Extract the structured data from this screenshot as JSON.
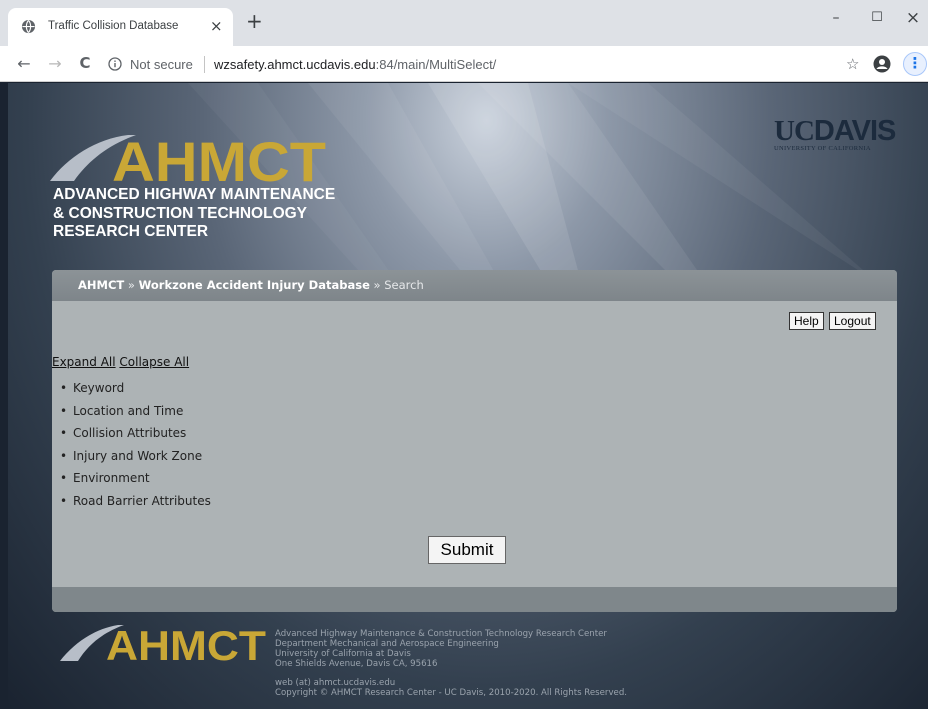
{
  "browser": {
    "tab_title": "Traffic Collision Database",
    "tab_close": "×",
    "new_tab": "+",
    "security_label": "Not secure",
    "url_host": "wzsafety.ahmct.ucdavis.edu",
    "url_path": ":84/main/MultiSelect/",
    "window_controls": {
      "minimize": "–",
      "maximize": "☐",
      "close": "×"
    },
    "nav": {
      "back": "←",
      "forward": "→",
      "reload": "C"
    },
    "bookmark_star": "☆",
    "menu": "⋮"
  },
  "header": {
    "logo_word": "AHMCT",
    "logo_lines": [
      "ADVANCED HIGHWAY MAINTENANCE",
      "& CONSTRUCTION TECHNOLOGY",
      "RESEARCH CENTER"
    ],
    "uc_prefix": "UC",
    "uc_name": "DAVIS",
    "uc_sub": "UNIVERSITY OF CALIFORNIA",
    "logo_color": "#c9a736"
  },
  "breadcrumb": {
    "home": "AHMCT",
    "separator": "»",
    "database": "Workzone Accident Injury Database",
    "current": "Search"
  },
  "buttons": {
    "help": "Help",
    "logout": "Logout",
    "submit": "Submit"
  },
  "links": {
    "expand_all": "Expand All",
    "collapse_all": "Collapse All"
  },
  "sections": [
    "Keyword",
    "Location and Time",
    "Collision Attributes",
    "Injury and Work Zone",
    "Environment",
    "Road Barrier Attributes"
  ],
  "footer": {
    "logo_word": "AHMCT",
    "address_lines": [
      "Advanced Highway Maintenance & Construction Technology Research Center",
      "Department Mechanical and Aerospace Engineering",
      "University of California at Davis",
      "One Shields Avenue, Davis CA, 95616"
    ],
    "contact": "web (at) ahmct.ucdavis.edu",
    "copyright": "Copyright © AHMCT Research Center - UC Davis, 2010-2020. All Rights Reserved."
  }
}
